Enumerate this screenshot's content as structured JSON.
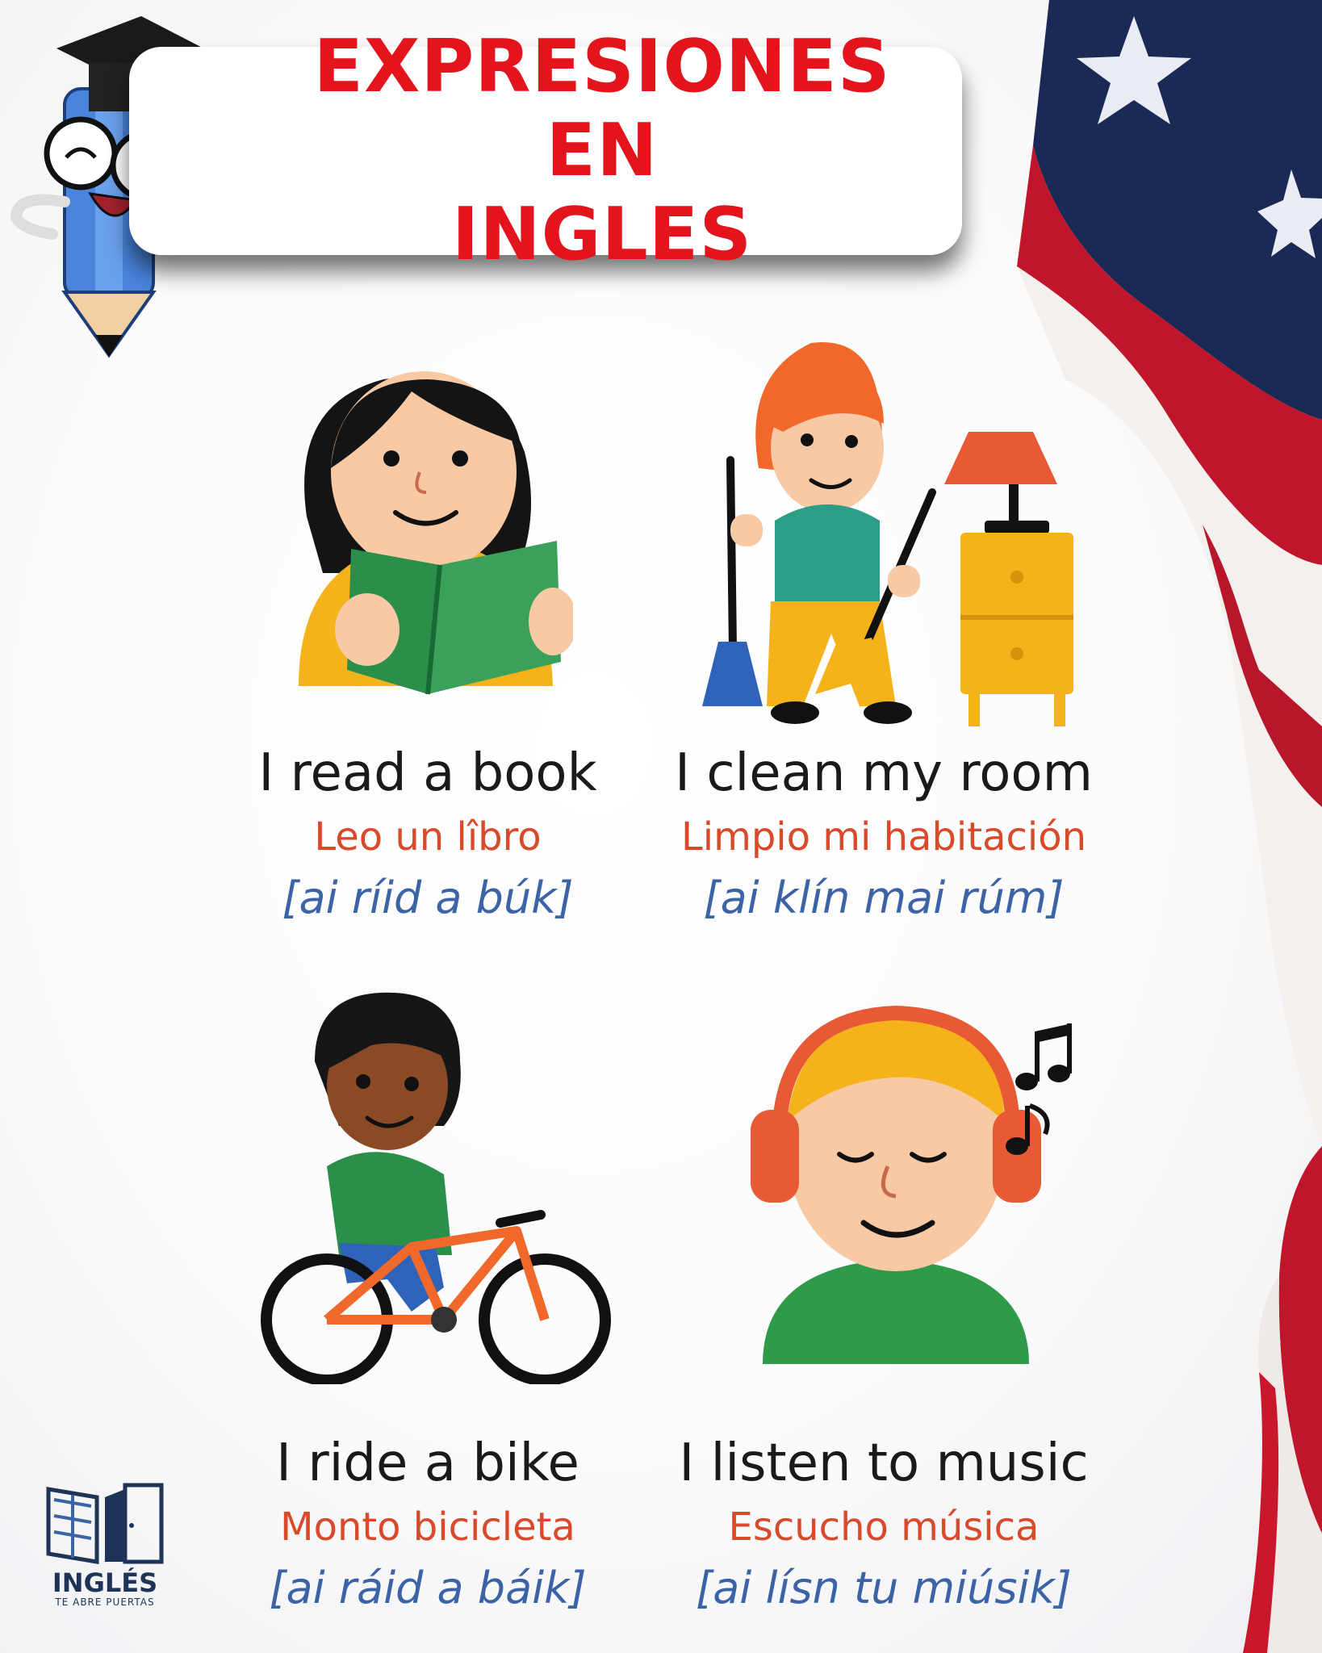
{
  "title": {
    "line1": "EXPRESIONES EN",
    "line2": "INGLES"
  },
  "cards": [
    {
      "english": "I read a book",
      "spanish": "Leo un lîbro",
      "pronunciation": "[ai ríid a búk]",
      "illustration": "girl-reading-book"
    },
    {
      "english": "I clean my room",
      "spanish": "Limpio mi habitación",
      "pronunciation": "[ai klín mai rúm]",
      "illustration": "boy-sweeping-room"
    },
    {
      "english": "I ride a bike",
      "spanish": "Monto bicicleta",
      "pronunciation": "[ai ráid a báik]",
      "illustration": "girl-riding-bike"
    },
    {
      "english": "I listen to music",
      "spanish": "Escucho música",
      "pronunciation": "[ai lísn tu miúsik]",
      "illustration": "boy-with-headphones"
    }
  ],
  "logo": {
    "name": "INGLÉS",
    "tagline": "TE ABRE PUERTAS"
  },
  "colors": {
    "title_red": "#e3141b",
    "translation_orange": "#d9492a",
    "pronunciation_blue": "#3b63a6",
    "logo_navy": "#1e3357"
  }
}
